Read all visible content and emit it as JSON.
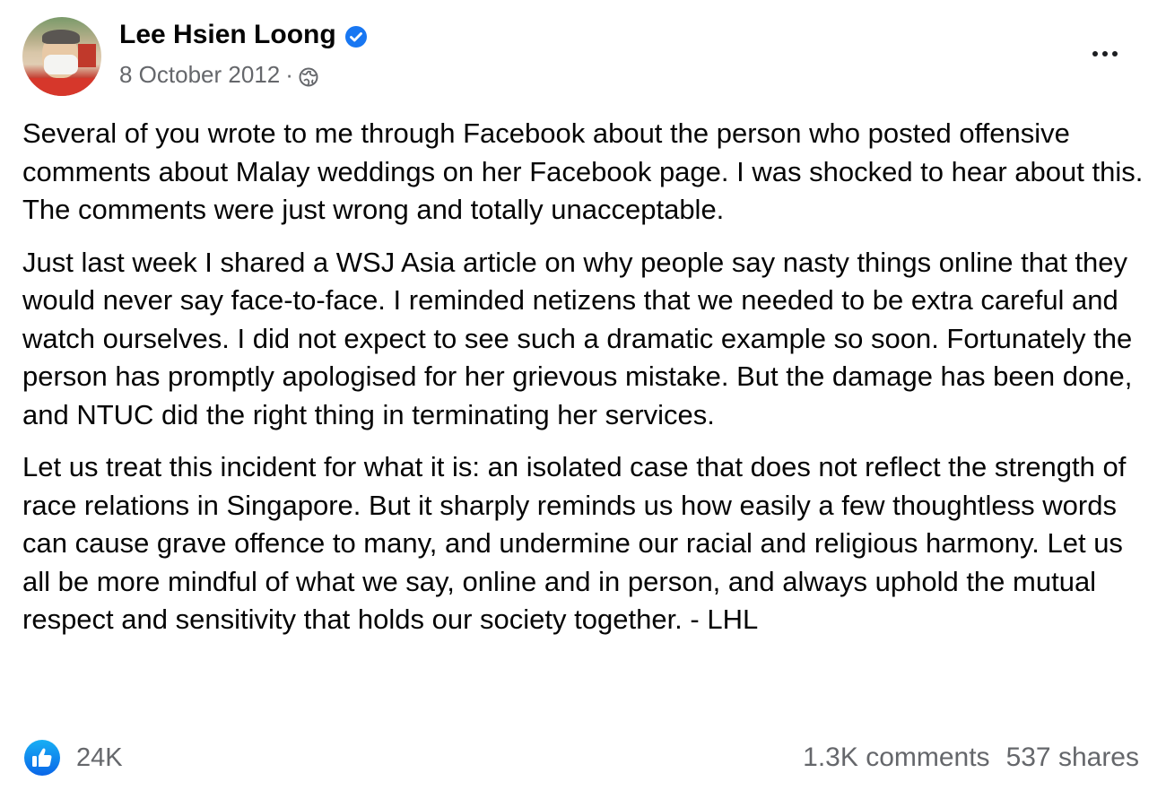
{
  "post": {
    "author": "Lee Hsien Loong",
    "date": "8 October 2012",
    "separator": "·",
    "paragraphs": [
      "Several of you wrote to me through Facebook about the person who posted offensive comments about Malay weddings on her Facebook page. I was shocked to hear about this. The comments were just wrong and totally unacceptable.",
      "Just last week I shared a WSJ Asia article on why people say nasty things online that they would never say face-to-face. I reminded netizens that we needed to be extra careful and watch ourselves. I did not expect to see such a dramatic example so soon. Fortunately the person has promptly apologised for her grievous mistake. But the damage has been done, and NTUC did the right thing in terminating her services.",
      "Let us treat this incident for what it is: an isolated case that does not reflect the strength of race relations in Singapore. But it sharply reminds us how easily a few thoughtless words can cause grave offence to many, and undermine our racial and religious harmony. Let us all be more mindful of what we say, online and in person, and always uphold the mutual respect and sensitivity that holds our society together. - LHL"
    ]
  },
  "footer": {
    "reaction_count": "24K",
    "comments": "1.3K comments",
    "shares": "537 shares"
  },
  "icons": {
    "verified": "verified-badge-icon",
    "audience": "globe-icon",
    "more": "more-options-icon",
    "like": "like-thumb-icon"
  },
  "colors": {
    "facebook_blue": "#1877f2",
    "secondary_text": "#65676b",
    "primary_text": "#050505"
  }
}
